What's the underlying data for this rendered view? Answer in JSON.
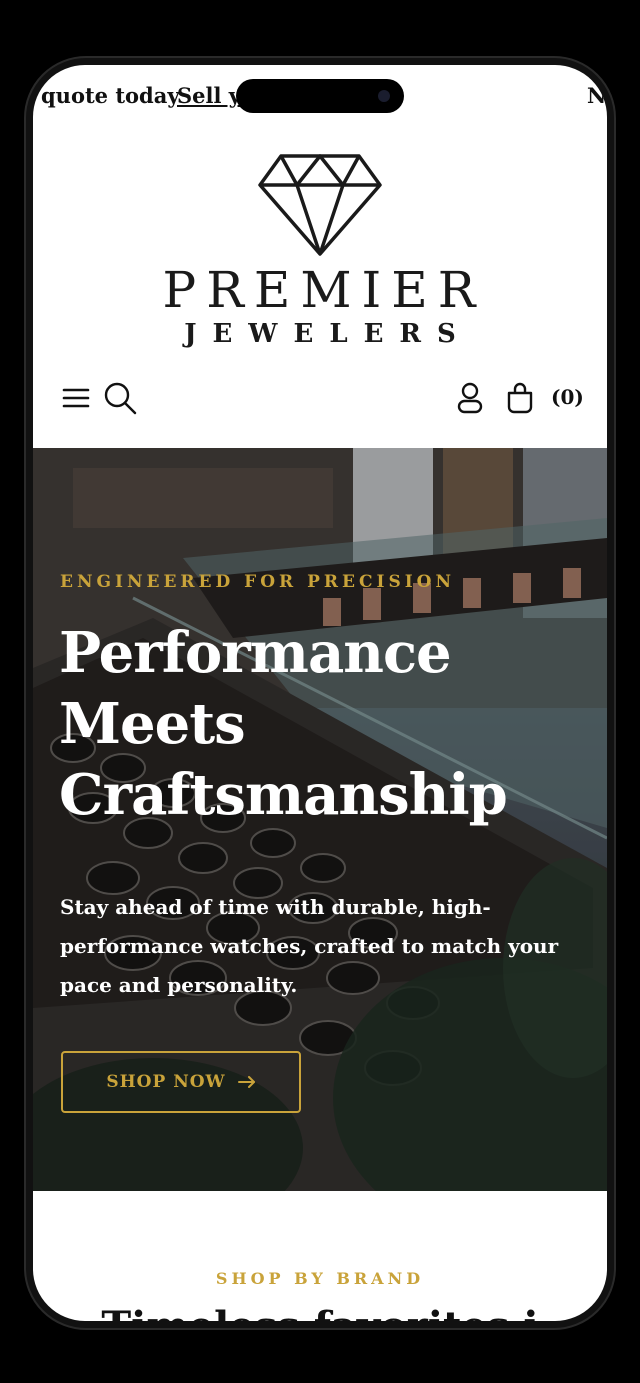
{
  "announcement": {
    "text_left": "quote today",
    "link": "Sell y",
    "text_right": "N"
  },
  "logo": {
    "name": "PREMIER",
    "sub": "JEWELERS",
    "mark_icon": "diamond-icon"
  },
  "header": {
    "menu_icon": "hamburger-icon",
    "search_icon": "search-icon",
    "account_icon": "user-icon",
    "cart_icon": "bag-icon",
    "cart_count": "(0)"
  },
  "hero": {
    "eyebrow": "ENGINEERED FOR PRECISION",
    "title": "Performance Meets Craftsmanship",
    "description": "Stay ahead of time with durable, high-performance watches, crafted to match your pace and personality.",
    "button_label": "SHOP NOW",
    "button_icon": "arrow-right-icon"
  },
  "brands": {
    "eyebrow": "SHOP BY BRAND",
    "heading": "Timeless favorites i"
  },
  "colors": {
    "accent_gold": "#c9a33a",
    "text_dark": "#111111",
    "background": "#ffffff"
  }
}
